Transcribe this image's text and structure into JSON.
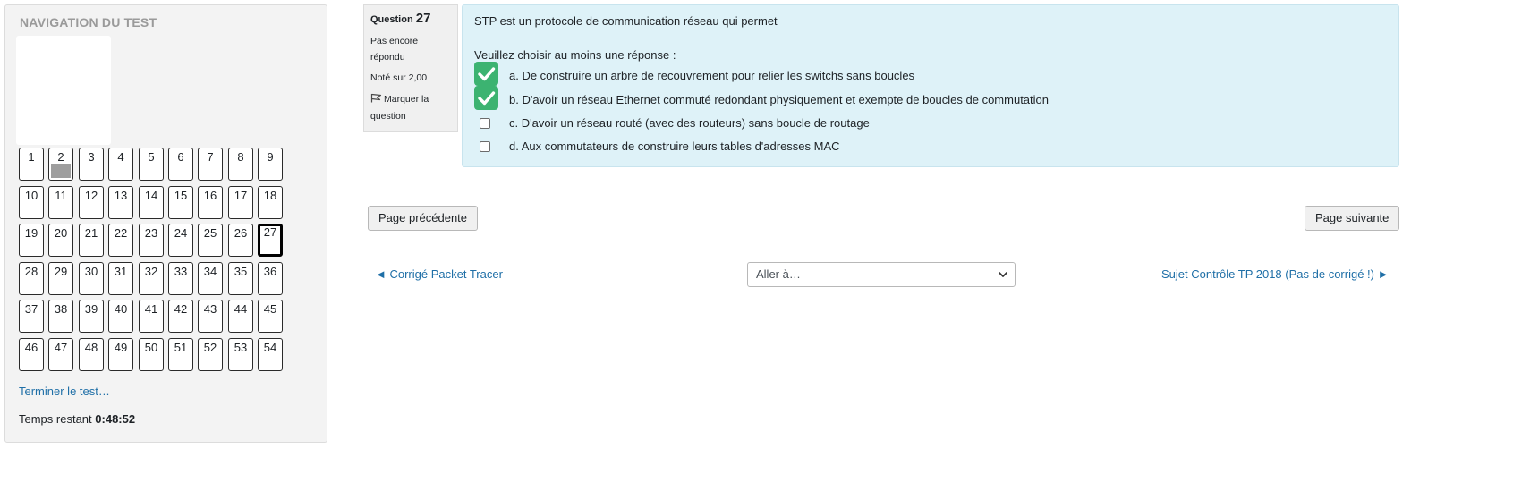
{
  "navigation": {
    "title": "NAVIGATION DU TEST",
    "questions": [
      "1",
      "2",
      "3",
      "4",
      "5",
      "6",
      "7",
      "8",
      "9",
      "10",
      "11",
      "12",
      "13",
      "14",
      "15",
      "16",
      "17",
      "18",
      "19",
      "20",
      "21",
      "22",
      "23",
      "24",
      "25",
      "26",
      "27",
      "28",
      "29",
      "30",
      "31",
      "32",
      "33",
      "34",
      "35",
      "36",
      "37",
      "38",
      "39",
      "40",
      "41",
      "42",
      "43",
      "44",
      "45",
      "46",
      "47",
      "48",
      "49",
      "50",
      "51",
      "52",
      "53",
      "54"
    ],
    "current_question": "27",
    "flagged_question": "2",
    "finish_link": "Terminer le test…",
    "time_label": "Temps restant",
    "time_value": "0:48:52"
  },
  "question_info": {
    "prefix": "Question",
    "number": "27",
    "state": "Pas encore répondu",
    "grade": "Noté sur 2,00",
    "flag_label": "Marquer la question"
  },
  "question": {
    "text": "STP est un protocole de communication réseau qui permet",
    "prompt": "Veuillez choisir au moins une réponse :",
    "answers": [
      {
        "label": "a. De construire un arbre de recouvrement pour relier les switchs sans boucles",
        "checked": true
      },
      {
        "label": "b. D'avoir un réseau Ethernet commuté redondant physiquement et exempte de boucles de commutation",
        "checked": true
      },
      {
        "label": "c. D'avoir un réseau routé (avec des routeurs) sans boucle de routage",
        "checked": false
      },
      {
        "label": "d. Aux commutateurs de construire leurs tables d'adresses MAC",
        "checked": false
      }
    ],
    "check_color": "#3cb371"
  },
  "buttons": {
    "prev_page": "Page précédente",
    "next_page": "Page suivante"
  },
  "activity_nav": {
    "prev_link": "◄ Corrigé Packet Tracer",
    "jump_placeholder": "Aller à…",
    "next_link": "Sujet Contrôle TP 2018 (Pas de corrigé !) ►"
  },
  "colors": {
    "link": "#1f6fa7",
    "question_bg": "#def2f8",
    "panel_bg": "#f3f3f3"
  }
}
